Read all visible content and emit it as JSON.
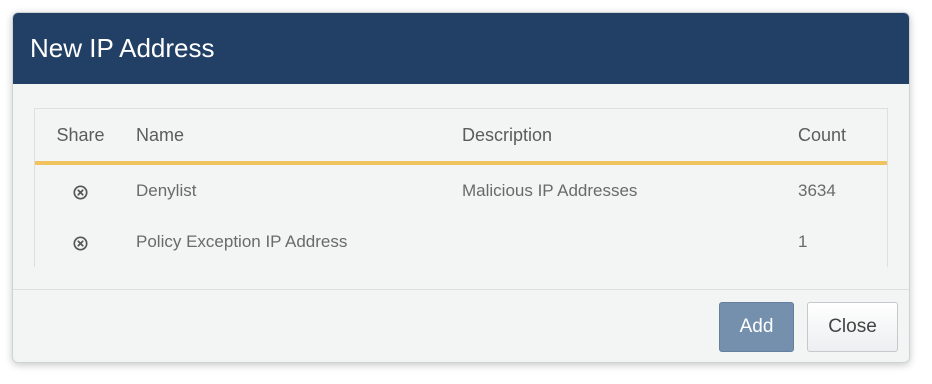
{
  "dialog": {
    "title": "New IP Address"
  },
  "table": {
    "columns": {
      "share": "Share",
      "name": "Name",
      "description": "Description",
      "count": "Count"
    },
    "rows": [
      {
        "share_icon": "circle-x-icon",
        "name": "Denylist",
        "description": "Malicious IP Addresses",
        "count": "3634"
      },
      {
        "share_icon": "circle-x-icon",
        "name": "Policy Exception IP Address",
        "description": "",
        "count": "1"
      }
    ]
  },
  "footer": {
    "add_label": "Add",
    "close_label": "Close"
  },
  "colors": {
    "header_bg": "#223f66",
    "header_underline": "#f0c35e",
    "add_button_bg": "#7590ad"
  }
}
